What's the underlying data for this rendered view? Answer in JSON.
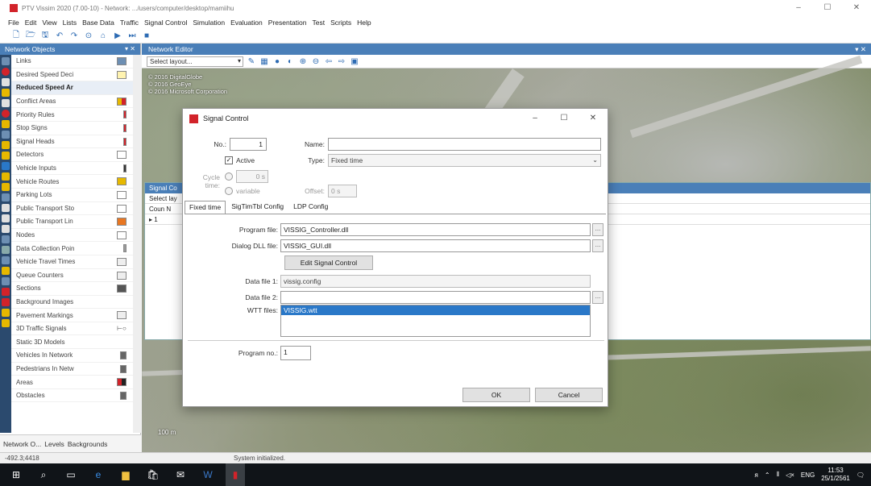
{
  "window": {
    "title": "PTV Vissim 2020 (7.00-10) - Network: .../users/computer/desktop/mamiihu",
    "controls": {
      "minimize": "–",
      "maximize": "☐",
      "close": "✕"
    }
  },
  "menu": [
    "File",
    "Edit",
    "View",
    "Lists",
    "Base Data",
    "Traffic",
    "Signal Control",
    "Simulation",
    "Evaluation",
    "Presentation",
    "Test",
    "Scripts",
    "Help"
  ],
  "left_panel": {
    "title": "Network Objects",
    "items": [
      {
        "label": "Links"
      },
      {
        "label": "Desired Speed Deci"
      },
      {
        "label": "Reduced Speed Ar"
      },
      {
        "label": "Conflict Areas"
      },
      {
        "label": "Priority Rules"
      },
      {
        "label": "Stop Signs"
      },
      {
        "label": "Signal Heads"
      },
      {
        "label": "Detectors"
      },
      {
        "label": "Vehicle Inputs"
      },
      {
        "label": "Vehicle Routes"
      },
      {
        "label": "Parking Lots"
      },
      {
        "label": "Public Transport Sto"
      },
      {
        "label": "Public Transport Lin"
      },
      {
        "label": "Nodes"
      },
      {
        "label": "Data Collection Poin"
      },
      {
        "label": "Vehicle Travel Times"
      },
      {
        "label": "Queue Counters"
      },
      {
        "label": "Sections"
      },
      {
        "label": "Background Images"
      },
      {
        "label": "Pavement Markings"
      },
      {
        "label": "3D Traffic Signals"
      },
      {
        "label": "Static 3D Models"
      },
      {
        "label": "Vehicles In Network"
      },
      {
        "label": "Pedestrians In Netw"
      },
      {
        "label": "Areas"
      },
      {
        "label": "Obstacles"
      }
    ],
    "tabs": [
      "Network O...",
      "Levels",
      "Backgrounds"
    ]
  },
  "editor": {
    "title": "Network Editor",
    "layout_select": "Select layout...",
    "map_copyright": [
      "© 2016 DigitalGlobe",
      "© 2016 GeoEye",
      "© 2016 Microsoft Corporation"
    ],
    "scale": "100 m"
  },
  "sc_list": {
    "title": "Signal Co",
    "layout": "Select lay",
    "col": "Coun  N",
    "row": "▸  1"
  },
  "dialog": {
    "title": "Signal Control",
    "no_label": "No.:",
    "no_value": "1",
    "name_label": "Name:",
    "name_value": "",
    "active_label": "Active",
    "type_label": "Type:",
    "type_value": "Fixed time",
    "cycle_label": "Cycle time:",
    "cycle_value": "0 s",
    "variable_label": "variable",
    "offset_label": "Offset:",
    "offset_value": "0 s",
    "tabs": [
      "Fixed time",
      "SigTimTbl Config",
      "LDP Config"
    ],
    "program_file_label": "Program file:",
    "program_file_value": "VISSIG_Controller.dll",
    "dialog_dll_label": "Dialog DLL file:",
    "dialog_dll_value": "VISSIG_GUI.dll",
    "edit_button": "Edit Signal Control",
    "data_file1_label": "Data file 1:",
    "data_file1_value": "vissig.config",
    "data_file2_label": "Data file 2:",
    "data_file2_value": "",
    "wtt_label": "WTT files:",
    "wtt_items": [
      "VISSIG.wtt"
    ],
    "program_no_label": "Program no.:",
    "program_no_value": "1",
    "ok": "OK",
    "cancel": "Cancel",
    "browse": "..."
  },
  "status": {
    "coords": "-492.3;4418",
    "message": "System initialized."
  },
  "taskbar": {
    "lang": "ENG",
    "time": "11:53",
    "date": "25/1/2561"
  },
  "colors": {
    "header_blue": "#4a7fb8",
    "selection_blue": "#2a78c8",
    "vissim_red": "#d2232a"
  }
}
